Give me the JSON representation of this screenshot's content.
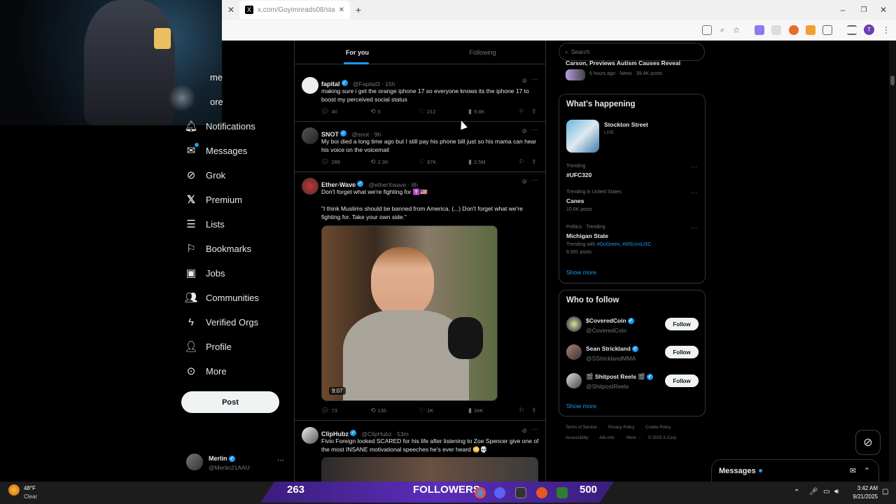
{
  "browser": {
    "tab_url": "x.com/Goyimreads08/status/1",
    "close_glyph": "✕",
    "new_tab_glyph": "+",
    "window_controls": [
      "–",
      "❐",
      "✕"
    ]
  },
  "nav": {
    "items": [
      {
        "label": "me",
        "icon": "home-icon"
      },
      {
        "label": "ore",
        "icon": "explore-icon"
      },
      {
        "label": "Notifications",
        "icon": "bell-icon"
      },
      {
        "label": "Messages",
        "icon": "envelope-icon"
      },
      {
        "label": "Grok",
        "icon": "grok-icon"
      },
      {
        "label": "Premium",
        "icon": "x-logo-icon"
      },
      {
        "label": "Lists",
        "icon": "list-icon"
      },
      {
        "label": "Bookmarks",
        "icon": "bookmark-icon"
      },
      {
        "label": "Jobs",
        "icon": "briefcase-icon"
      },
      {
        "label": "Communities",
        "icon": "people-icon"
      },
      {
        "label": "Verified Orgs",
        "icon": "lightning-icon"
      },
      {
        "label": "Profile",
        "icon": "person-icon"
      },
      {
        "label": "More",
        "icon": "more-circle-icon"
      }
    ],
    "post_label": "Post",
    "account": {
      "name": "Merlin",
      "handle": "@Merlin21AAU"
    }
  },
  "feed": {
    "tabs": [
      {
        "label": "For you",
        "active": true
      },
      {
        "label": "Following",
        "active": false
      }
    ],
    "tweets": [
      {
        "name": "fapital",
        "handle": "@Fapital3 · 15h",
        "text": "making sure i get the orange iphone 17 so everyone knows its the iphone 17 to boost my perceived social status",
        "replies": "40",
        "reposts": "5",
        "likes": "212",
        "views": "9.8K"
      },
      {
        "name": "SNOT",
        "handle": "@snot · 9h",
        "text": "My boi died a long time ago but I still pay his phone bill just so his mama can hear his voice on the voicemail",
        "replies": "289",
        "reposts": "2.3K",
        "likes": "87K",
        "views": "2.5M"
      },
      {
        "name": "Ether-Wave",
        "handle": "@etherXwave · 8h",
        "text": "Don't forget what we're fighting for ✝️🇺🇸",
        "quote": "\"I think Muslims should be banned from America. (...) Don't forget what we're fighting for. Take your own side.\"",
        "video_duration": "9:07",
        "replies": "73",
        "reposts": "135",
        "likes": "1K",
        "views": "34K"
      },
      {
        "name": "ClipHubz",
        "handle": "@ClipHubz · 53m",
        "text": "Fivio Foreign looked SCARED for his life after listening to Zoe Spencer give one of the most INSANE motivational speeches he's ever heard 😳💀"
      }
    ]
  },
  "sidebar": {
    "search_placeholder": "Search",
    "top_news": {
      "headline": "Carson, Previews Autism Causes Reveal",
      "meta": "6 hours ago · News · 39.4K posts"
    },
    "whats_happening": {
      "title": "What's happening",
      "live": {
        "name": "Stockton Street",
        "status": "LIVE"
      },
      "trends": [
        {
          "meta": "Trending",
          "name": "#UFC320",
          "sub": ""
        },
        {
          "meta": "Trending in United States",
          "name": "Canes",
          "sub": "10.6K posts"
        },
        {
          "meta": "Politics · Trending",
          "name": "Michigan State",
          "sub": "8,991 posts",
          "with_prefix": "Trending with ",
          "with_tags": "#GoGreen, #MSUvsUSC"
        }
      ],
      "show_more": "Show more"
    },
    "who_to_follow": {
      "title": "Who to follow",
      "accounts": [
        {
          "name": "$CoveredCoin",
          "handle": "@CoveredCoin",
          "button": "Follow"
        },
        {
          "name": "Sean Strickland",
          "handle": "@SStricklandMMA",
          "button": "Follow"
        },
        {
          "name": "🎬 Shitpost Reels 🎬",
          "handle": "@ShitpostReels",
          "button": "Follow"
        }
      ],
      "show_more": "Show more"
    },
    "footer": [
      "Terms of Service",
      "Privacy Policy",
      "Cookie Policy",
      "Accessibility",
      "Ads info",
      "More ···",
      "© 2025 X Corp."
    ]
  },
  "messages_drawer": {
    "label": "Messages"
  },
  "taskbar": {
    "weather_temp": "48°F",
    "weather_desc": "Clear",
    "banner_left": "263",
    "banner_center": "FOLLOWERS",
    "banner_right": "500",
    "time": "3:42 AM",
    "date": "9/21/2025"
  },
  "colors": {
    "accent": "#1d9bf0",
    "bg": "#000000",
    "border": "#2f3336",
    "muted": "#71767b",
    "banner": "#5b2db8"
  }
}
